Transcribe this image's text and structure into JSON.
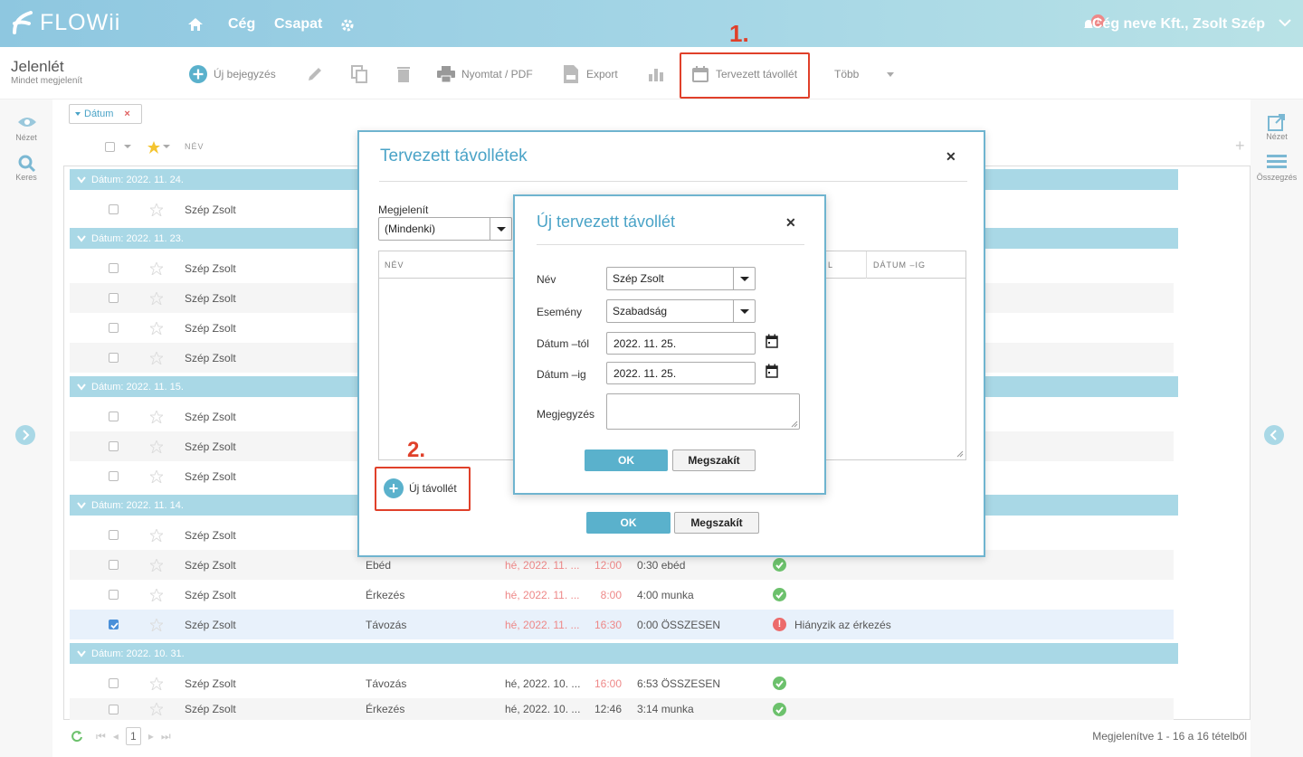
{
  "topbar": {
    "logo": "FLOWii",
    "nav": [
      "Cég",
      "Csapat"
    ],
    "notification_count": "1",
    "company_user": "Cég neve Kft., Zsolt Szép"
  },
  "page": {
    "title": "Jelenlét",
    "subtitle": "Mindet megjelenít"
  },
  "toolbar": {
    "new_entry": "Új bejegyzés",
    "print": "Nyomtat / PDF",
    "export": "Export",
    "planned_absence": "Tervezett távollét",
    "more": "Több"
  },
  "annotations": {
    "step1": "1.",
    "step2": "2."
  },
  "left_sidebar": {
    "view": "Nézet",
    "search": "Keres"
  },
  "right_sidebar": {
    "view": "Nézet",
    "summary": "Összegzés"
  },
  "filter": {
    "chip": "Dátum"
  },
  "grid": {
    "col_name": "NÉV",
    "groups": [
      {
        "label": "Dátum: 2022. 11. 24."
      },
      {
        "label": "Dátum: 2022. 11. 23."
      },
      {
        "label": "Dátum: 2022. 11. 15."
      },
      {
        "label": "Dátum: 2022. 11. 14."
      },
      {
        "label": "Dátum: 2022. 10. 31."
      }
    ],
    "rows": [
      {
        "name": "Szép Zsolt"
      },
      {
        "name": "Szép Zsolt"
      },
      {
        "name": "Szép Zsolt"
      },
      {
        "name": "Szép Zsolt"
      },
      {
        "name": "Szép Zsolt"
      },
      {
        "name": "Szép Zsolt"
      },
      {
        "name": "Szép Zsolt"
      },
      {
        "name": "Szép Zsolt"
      },
      {
        "name": "Szép Zsolt"
      },
      {
        "name": "Szép Zsolt",
        "event": "Ebéd",
        "date": "hé, 2022. 11. ...",
        "time": "12:00",
        "duration": "0:30 ebéd",
        "status": "ok"
      },
      {
        "name": "Szép Zsolt",
        "event": "Érkezés",
        "date": "hé, 2022. 11. ...",
        "time": "8:00",
        "duration": "4:00 munka",
        "status": "ok"
      },
      {
        "name": "Szép Zsolt",
        "event": "Távozás",
        "date": "hé, 2022. 11. ...",
        "time": "16:30",
        "duration": "0:00 ÖSSZESEN",
        "status": "error",
        "message": "Hiányzik az érkezés"
      },
      {
        "name": "Szép Zsolt",
        "event": "Távozás",
        "date": "hé, 2022. 10. ...",
        "time": "16:00",
        "duration": "6:53 ÖSSZESEN",
        "status": "ok"
      },
      {
        "name": "Szép Zsolt",
        "event": "Érkezés",
        "date": "hé, 2022. 10. ...",
        "time": "12:46",
        "duration": "3:14 munka",
        "status": "ok"
      }
    ]
  },
  "pager": {
    "page": "1",
    "summary": "Megjelenítve 1 - 16 a 16 tételből"
  },
  "modal_planned": {
    "title": "Tervezett távollétek",
    "show_label": "Megjelenít",
    "show_value": "(Mindenki)",
    "col_name": "NÉV",
    "col_from": "L",
    "col_to": "DÁTUM –IG",
    "new_absence": "Új távollét",
    "ok": "OK",
    "cancel": "Megszakít"
  },
  "modal_new": {
    "title": "Új tervezett távollét",
    "name_label": "Név",
    "name_value": "Szép Zsolt",
    "event_label": "Esemény",
    "event_value": "Szabadság",
    "from_label": "Dátum –tól",
    "from_value": "2022. 11. 25.",
    "to_label": "Dátum –ig",
    "to_value": "2022. 11. 25.",
    "note_label": "Megjegyzés",
    "note_value": "",
    "ok": "OK",
    "cancel": "Megszakít"
  },
  "colors": {
    "accent": "#4aa3c7",
    "highlight": "#e0402a",
    "ok": "#6cc16c",
    "error": "#ec6b6b"
  }
}
